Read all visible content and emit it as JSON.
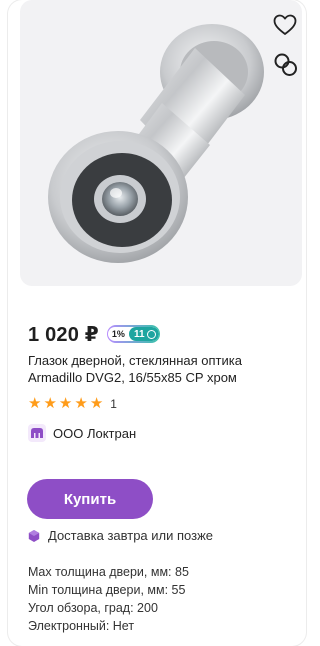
{
  "product": {
    "price": "1 020 ₽",
    "cashback_percent": "1%",
    "bonus_points": "11",
    "title": "Глазок дверной, стеклянная оптика Armadillo DVG2, 16/55x85 CP хром",
    "rating_count": "1",
    "stars": 5,
    "seller": "ООО Локтран",
    "buy_label": "Купить",
    "delivery": "Доставка завтра или позже",
    "specs": [
      "Max толщина двери, мм: 85",
      "Min толщина двери, мм: 55",
      "Угол обзора, град: 200",
      "Электронный: Нет"
    ]
  },
  "colors": {
    "accent": "#8e4ec6",
    "star": "#ff9c1a",
    "bonus": "#1ea5a0"
  },
  "icons": {
    "favorite": "heart-icon",
    "compare": "compare-icon",
    "seller": "seller-logo-icon",
    "delivery": "delivery-icon",
    "bonus": "bonus-coin-icon"
  }
}
